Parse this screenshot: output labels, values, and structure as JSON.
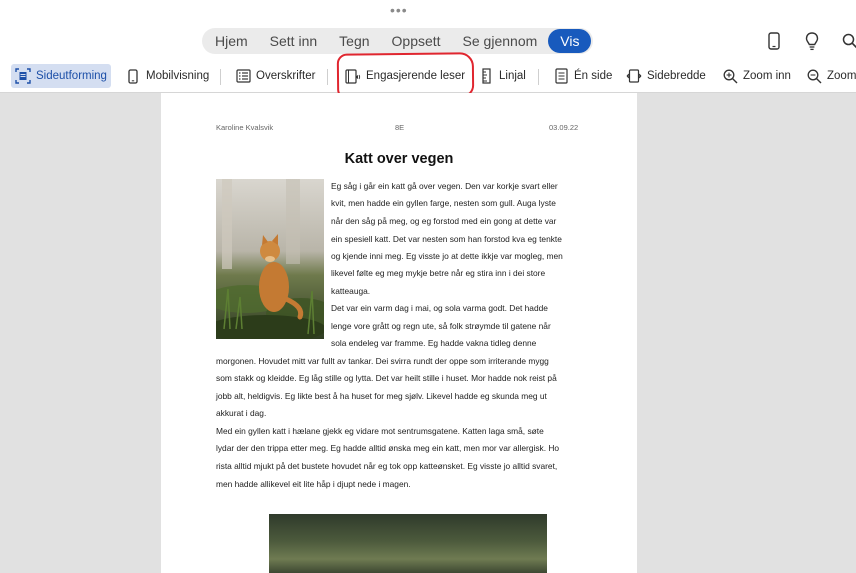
{
  "tabs": [
    "Hjem",
    "Sett inn",
    "Tegn",
    "Oppsett",
    "Se gjennom",
    "Vis"
  ],
  "active_tab": "Vis",
  "ribbon": {
    "sideutforming": "Sideutforming",
    "mobilvisning": "Mobilvisning",
    "overskrifter": "Overskrifter",
    "engasjerende_leser": "Engasjerende leser",
    "linjal": "Linjal",
    "en_side": "Én side",
    "sidebredde": "Sidebredde",
    "zoom_inn": "Zoom inn",
    "zoom_ut": "Zoom"
  },
  "icons": {
    "tablet": "tablet-icon",
    "lightbulb": "lightbulb-icon",
    "search": "search-icon"
  },
  "colors": {
    "accent": "#185abd",
    "highlight": "#e0262f"
  },
  "document": {
    "author": "Karoline Kvalsvik",
    "class": "8E",
    "date": "03.09.22",
    "title": "Katt over vegen",
    "lines": [
      "Eg såg i går ein katt gå over vegen. Den var korkje svart eller",
      "kvit, men hadde ein gyllen farge, nesten som gull. Auga lyste",
      "når den såg på meg, og eg forstod med ein gong at dette var",
      "ein spesiell katt. Det var nesten som han forstod kva eg tenkte",
      "og kjende inni meg. Eg visste jo at dette ikkje var mogleg, men",
      "likevel følte eg meg mykje betre når eg stira inn i dei store",
      "katteauga.",
      "Det var ein varm dag i mai, og sola varma godt. Det hadde",
      "lenge vore grått og regn ute, så folk strøymde til gatene når",
      "sola endeleg var framme. Eg hadde vakna tidleg denne",
      "morgonen. Hovudet mitt var fullt av tankar. Dei svirra rundt der oppe som irriterande mygg",
      "som stakk og kleidde. Eg låg stille og lytta. Det var heilt stille i huset. Mor hadde nok reist på",
      "jobb alt, heldigvis. Eg likte best å ha huset for meg sjølv. Likevel hadde eg skunda meg ut",
      "akkurat i dag.",
      "Med ein gyllen katt i hælane gjekk eg vidare mot sentrumsgatene. Katten laga små, søte",
      "lydar der den trippa etter meg. Eg hadde alltid ønska meg ein katt, men mor var allergisk. Ho",
      "rista alltid mjukt på det bustete hovudet når eg tok opp katteønsket. Eg visste jo alltid svaret,",
      "men hadde allikevel eit lite håp i djupt nede i magen."
    ]
  }
}
